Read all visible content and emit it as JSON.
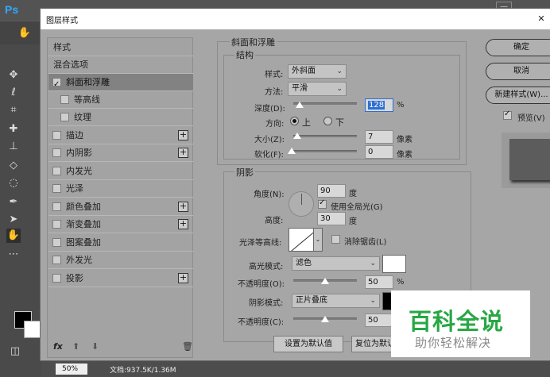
{
  "photoshop": {
    "logo": "Ps",
    "zoom": "50%",
    "doc_info": "文档:937.5K/1.36M"
  },
  "dialog": {
    "title": "图层样式",
    "close_glyph": "✕",
    "style_list": {
      "items": [
        {
          "label": "样式"
        },
        {
          "label": "混合选项"
        },
        {
          "label": "斜面和浮雕"
        },
        {
          "label": "等高线"
        },
        {
          "label": "纹理"
        },
        {
          "label": "描边"
        },
        {
          "label": "内阴影"
        },
        {
          "label": "内发光"
        },
        {
          "label": "光泽"
        },
        {
          "label": "颜色叠加"
        },
        {
          "label": "渐变叠加"
        },
        {
          "label": "图案叠加"
        },
        {
          "label": "外发光"
        },
        {
          "label": "投影"
        }
      ],
      "footer": {
        "fx": "fx",
        "up": "⬆",
        "down": "⬇",
        "delete": "🗑"
      }
    },
    "bevel": {
      "group_title": "斜面和浮雕",
      "structure_title": "结构",
      "style_label": "样式:",
      "style_value": "外斜面",
      "method_label": "方法:",
      "method_value": "平滑",
      "depth_label": "深度(D):",
      "depth_value": "128",
      "depth_unit": "%",
      "direction_label": "方向:",
      "direction_up": "上",
      "direction_down": "下",
      "size_label": "大小(Z):",
      "size_value": "7",
      "size_unit": "像素",
      "soften_label": "软化(F):",
      "soften_value": "0",
      "soften_unit": "像素"
    },
    "shading": {
      "group_title": "阴影",
      "angle_label": "角度(N):",
      "angle_value": "90",
      "angle_unit": "度",
      "global_light_label": "使用全局光(G)",
      "altitude_label": "高度:",
      "altitude_value": "30",
      "altitude_unit": "度",
      "gloss_contour_label": "光泽等高线:",
      "anti_alias_label": "消除锯齿(L)",
      "highlight_mode_label": "高光模式:",
      "highlight_mode_value": "滤色",
      "highlight_color": "#ffffff",
      "highlight_opacity_label": "不透明度(O):",
      "highlight_opacity_value": "50",
      "highlight_opacity_unit": "%",
      "shadow_mode_label": "阴影模式:",
      "shadow_mode_value": "正片叠底",
      "shadow_color": "#000000",
      "shadow_opacity_label": "不透明度(C):",
      "shadow_opacity_value": "50"
    },
    "buttons": {
      "make_default": "设置为默认值",
      "reset_default": "复位为默认",
      "ok": "确定",
      "cancel": "取消",
      "new_style": "新建样式(W)...",
      "preview": "预览(V)"
    }
  },
  "watermark": {
    "title": "百科全说",
    "subtitle": "助你轻松解决"
  }
}
